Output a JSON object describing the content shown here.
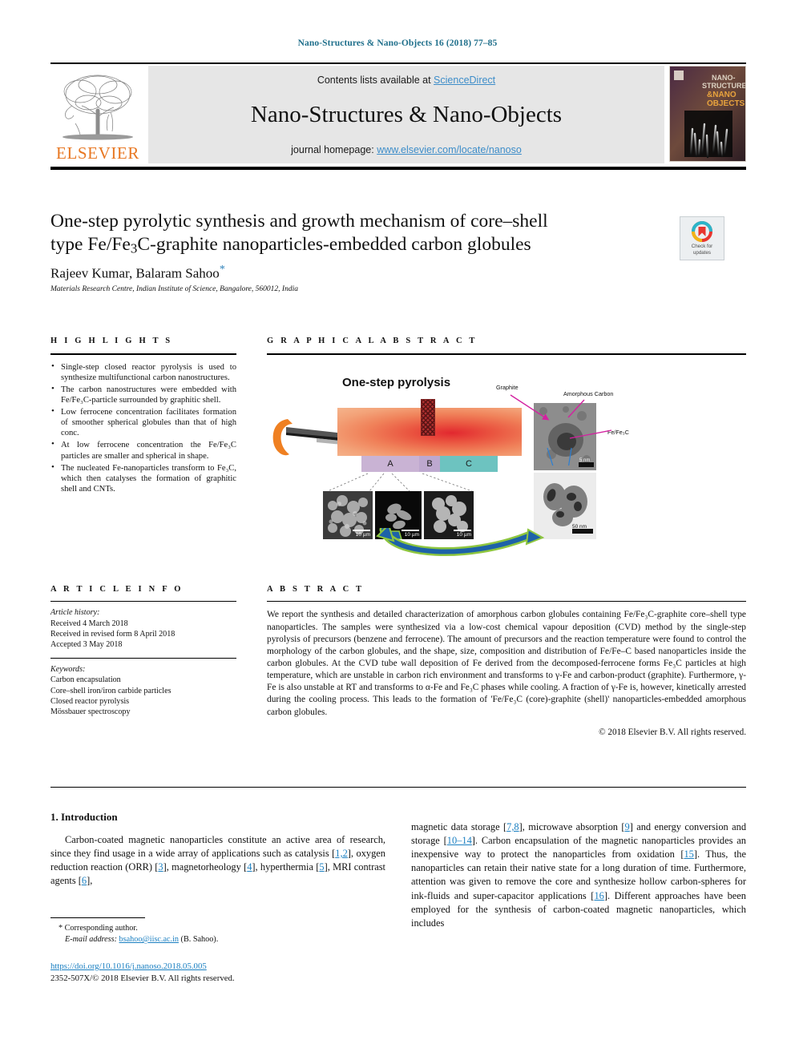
{
  "running_head": "Nano-Structures & Nano-Objects 16 (2018) 77–85",
  "masthead": {
    "contents_prefix": "Contents lists available at ",
    "sciencedirect": "ScienceDirect",
    "journal_title": "Nano-Structures & Nano-Objects",
    "homepage_prefix": "journal homepage: ",
    "homepage_url": "www.elsevier.com/locate/nanoso",
    "publisher": "ELSEVIER",
    "cover_title_lines": [
      "NANO-",
      "STRUCTURES",
      "&NANO",
      "OBJECTS"
    ],
    "link_color": "#3d8dc9",
    "elsevier_orange": "#E87722"
  },
  "title_block": {
    "title_line1": "One-step pyrolytic synthesis and growth mechanism of core–shell",
    "title_line2_a": "type Fe/Fe",
    "title_line2_sub": "3",
    "title_line2_b": "C-graphite nanoparticles-embedded carbon globules",
    "authors": "Rajeev Kumar, Balaram Sahoo",
    "author_star": "*",
    "affiliation": "Materials Research Centre, Indian Institute of Science, Bangalore, 560012, India",
    "crossmark_label_line1": "Check for",
    "crossmark_label_line2": "updates"
  },
  "highlights": {
    "heading": "H I G H L I G H T S",
    "items": [
      "Single-step closed reactor pyrolysis is used to synthesize multifunctional carbon nanostructures.",
      "The carbon nanostructures were embedded with Fe/Fe₃C-particle surrounded by graphitic shell.",
      "Low ferrocene concentration facilitates formation of smoother spherical globules than that of high conc.",
      "At low ferrocene concentration the Fe/Fe₃C particles are smaller and spherical in shape.",
      "The nucleated Fe-nanoparticles transform to Fe₃C, which then catalyses the formation of graphitic shell and CNTs."
    ]
  },
  "graphical_abstract": {
    "heading": "G R A P H I C A L   A B S T R A C T",
    "figure_title": "One-step pyrolysis",
    "bands": [
      "A",
      "B",
      "C"
    ],
    "annotations": {
      "graphite": "Graphite",
      "amorphous_carbon": "Amorphous Carbon",
      "fe_fe3c": "Fe/Fe₃C"
    },
    "scale_bars": {
      "sem_a": "10 µm",
      "sem_b": "10 µm",
      "sem_c": "10 µm",
      "tem_top": "5 nm",
      "tem_bottom": "50 nm"
    }
  },
  "article_info": {
    "heading": "A R T I C L E   I N F O",
    "history_label": "Article history:",
    "history": [
      "Received 4 March 2018",
      "Received in revised form 8 April 2018",
      "Accepted 3 May 2018"
    ],
    "keywords_label": "Keywords:",
    "keywords": [
      "Carbon encapsulation",
      "Core–shell iron/iron carbide particles",
      "Closed reactor pyrolysis",
      "Mössbauer spectroscopy"
    ]
  },
  "abstract": {
    "heading": "A B S T R A C T",
    "text": "We report the synthesis and detailed characterization of amorphous carbon globules containing Fe/Fe₃C-graphite core–shell type nanoparticles. The samples were synthesized via a low-cost chemical vapour deposition (CVD) method by the single-step pyrolysis of precursors (benzene and ferrocene). The amount of precursors and the reaction temperature were found to control the morphology of the carbon globules, and the shape, size, composition and distribution of Fe/Fe–C based nanoparticles inside the carbon globules. At the CVD tube wall deposition of Fe derived from the decomposed-ferrocene forms Fe₃C particles at high temperature, which are unstable in carbon rich environment and transforms to γ-Fe and carbon-product (graphite). Furthermore, γ-Fe is also unstable at RT and transforms to α-Fe and Fe₃C phases while cooling. A fraction of γ-Fe is, however, kinetically arrested during the cooling process. This leads to the formation of 'Fe/Fe₃C (core)-graphite (shell)' nanoparticles-embedded amorphous carbon globules.",
    "copyright": "© 2018 Elsevier B.V. All rights reserved."
  },
  "introduction": {
    "heading": "1. Introduction",
    "left_paragraph_part1": "Carbon-coated  magnetic nanoparticles constitute an active area of research, since they find usage in a wide array of applications such as catalysis [",
    "left_ref1": "1,2",
    "left_part2": "], oxygen reduction reaction (ORR) [",
    "left_ref2": "3",
    "left_part3": "], magnetorheology [",
    "left_ref3": "4",
    "left_part4": "], hyperthermia [",
    "left_ref4": "5",
    "left_part5": "], MRI contrast agents [",
    "left_ref5": "6",
    "left_part6": "],",
    "right_part1": "magnetic data storage [",
    "right_ref1": "7,8",
    "right_part2": "], microwave absorption [",
    "right_ref2": "9",
    "right_part3": "] and energy conversion and storage [",
    "right_ref3": "10–14",
    "right_part4": "]. Carbon encapsulation of the magnetic nanoparticles provides an inexpensive way to protect the nanoparticles from oxidation [",
    "right_ref4": "15",
    "right_part5": "]. Thus, the nanoparticles can retain their native state for a long duration of time. Furthermore, attention was given to remove the core and synthesize hollow carbon-spheres for ink-fluids and super-capacitor applications [",
    "right_ref5": "16",
    "right_part6": "]. Different approaches have been employed for the synthesis of carbon-coated magnetic nanoparticles, which includes"
  },
  "footer": {
    "corresponding_mark": "*",
    "corresponding_label": " Corresponding author.",
    "email_label": "E-mail address:",
    "email": "bsahoo@iisc.ac.in",
    "email_suffix": " (B. Sahoo).",
    "doi": "https://doi.org/10.1016/j.nanoso.2018.05.005",
    "issn_line": "2352-507X/© 2018 Elsevier B.V. All rights reserved."
  }
}
